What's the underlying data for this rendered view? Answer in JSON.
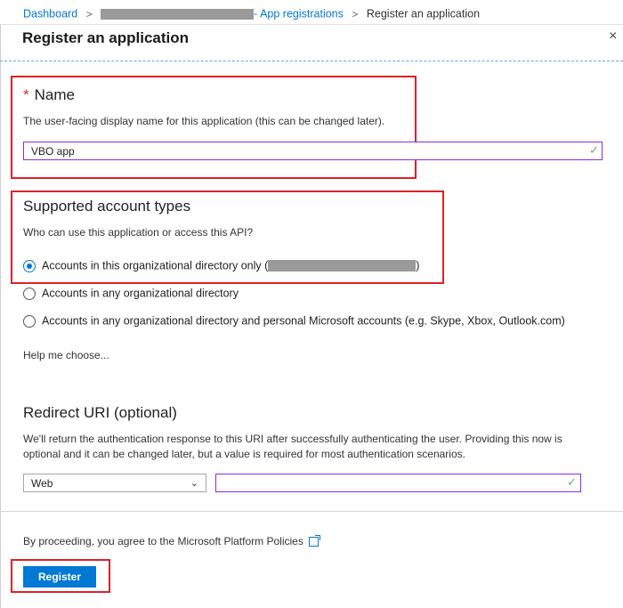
{
  "breadcrumb": {
    "items": [
      "Dashboard",
      "- App registrations",
      "Register an application"
    ],
    "separator": ">"
  },
  "panel": {
    "title": "Register an application",
    "close_glyph": "×"
  },
  "name_section": {
    "required_marker": "*",
    "title": "Name",
    "description": "The user-facing display name for this application (this can be changed later).",
    "input_value": "VBO app"
  },
  "account_types": {
    "title": "Supported account types",
    "question": "Who can use this application or access this API?",
    "options": [
      {
        "label": "Accounts in this organizational directory only (",
        "suffix": ")",
        "checked": true
      },
      {
        "label": "Accounts in any organizational directory",
        "checked": false
      },
      {
        "label": "Accounts in any organizational directory and personal Microsoft accounts (e.g. Skype, Xbox, Outlook.com)",
        "checked": false
      }
    ],
    "help_link": "Help me choose..."
  },
  "redirect": {
    "title": "Redirect URI (optional)",
    "description": "We'll return the authentication response to this URI after successfully authenticating the user. Providing this now is optional and it can be changed later, but a value is required for most authentication scenarios.",
    "platform_value": "Web",
    "uri_value": ""
  },
  "footer": {
    "policy_link": "By proceeding, you agree to the Microsoft Platform Policies",
    "register_label": "Register"
  },
  "colors": {
    "accent": "#0078d4",
    "highlight_box": "#e0202a",
    "valid_check": "#5cb85c",
    "input_focus_border": "#8a2be2"
  },
  "icons": {
    "valid": "check-icon",
    "dropdown": "chevron-down-icon",
    "external": "external-link-icon",
    "close": "close-icon"
  }
}
